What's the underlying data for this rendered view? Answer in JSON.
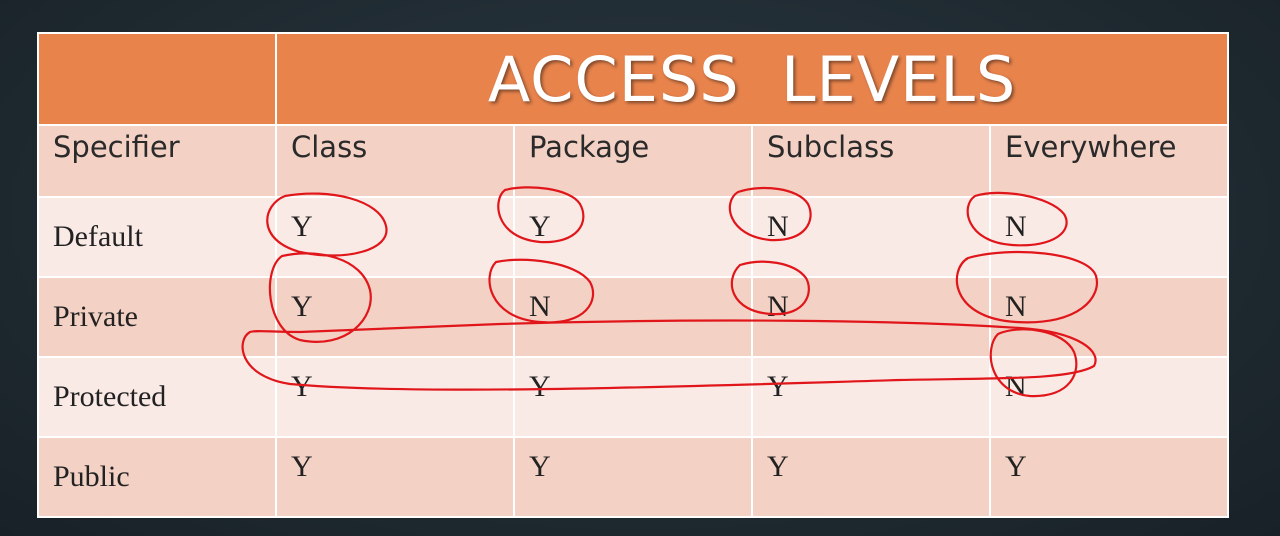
{
  "table": {
    "title": "ACCESS  LEVELS",
    "columns": [
      "Specifier",
      "Class",
      "Package",
      "Subclass",
      "Everywhere"
    ],
    "rows": [
      {
        "specifier": "Default",
        "values": [
          "Y",
          "Y",
          "N",
          "N"
        ]
      },
      {
        "specifier": "Private",
        "values": [
          "Y",
          "N",
          "N",
          "N"
        ]
      },
      {
        "specifier": "Protected",
        "values": [
          "Y",
          "Y",
          "Y",
          "N"
        ]
      },
      {
        "specifier": "Public",
        "values": [
          "Y",
          "Y",
          "Y",
          "Y"
        ]
      }
    ]
  },
  "colors": {
    "header": "#e8834c",
    "row_dark": "#f3d1c4",
    "row_light": "#faeae6",
    "annotation": "#e0161b",
    "background": "#1f2a31"
  }
}
